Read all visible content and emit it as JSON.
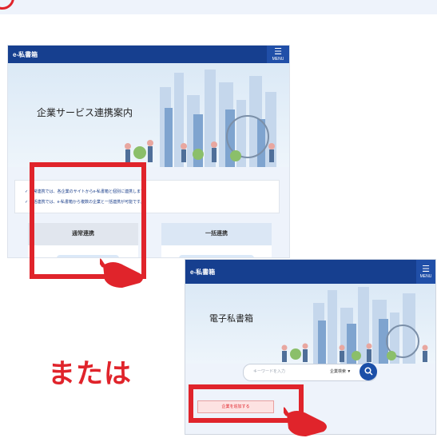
{
  "colors": {
    "brand_blue": "#163f8f",
    "accent_red": "#e0242b",
    "page_bg": "#ffffff",
    "panel_bg": "#eef3fb"
  },
  "screen1": {
    "logo": "e-私書箱",
    "menu_label": "MENU",
    "banner_title": "企業サービス連携案内",
    "info_lines": [
      "通常連携では、各企業のサイトからe-私書箱と個別に連携します。",
      "一括連携では、e-私書箱から複数の企業と一括連携が可能です。"
    ],
    "cards": [
      {
        "label": "通常連携",
        "highlighted": true
      },
      {
        "label": "一括連携",
        "highlighted": false
      }
    ]
  },
  "or_label": "または",
  "screen2": {
    "logo": "e-私書箱",
    "menu_label": "MENU",
    "banner_title": "電子私書箱",
    "search": {
      "placeholder": "キーワードを入力",
      "filter_label": "企業検索",
      "filter_caret": "▼"
    },
    "business_button": "企業を追加する"
  }
}
